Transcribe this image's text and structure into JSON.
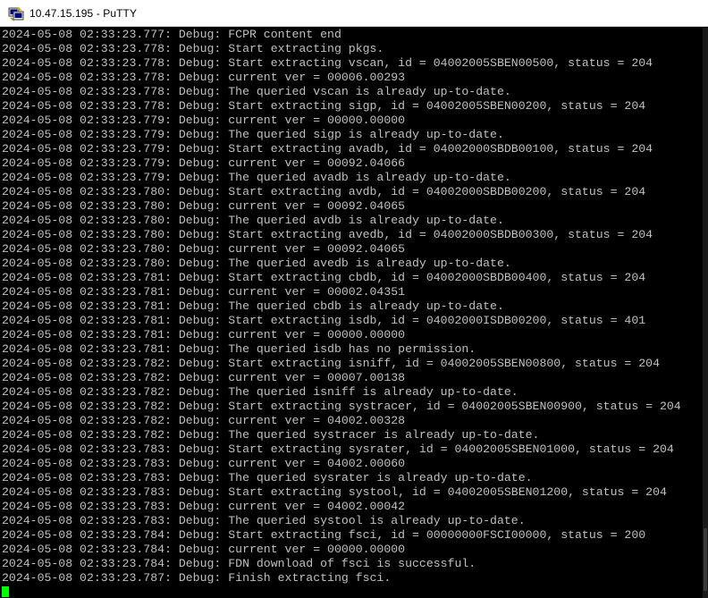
{
  "window": {
    "title": "10.47.15.195 - PuTTY",
    "icon": "putty-icon"
  },
  "terminal": {
    "lines": [
      "2024-05-08 02:33:23.777: Debug: FCPR content end",
      "2024-05-08 02:33:23.778: Debug: Start extracting pkgs.",
      "2024-05-08 02:33:23.778: Debug: Start extracting vscan, id = 04002005SBEN00500, status = 204",
      "2024-05-08 02:33:23.778: Debug: current ver = 00006.00293",
      "2024-05-08 02:33:23.778: Debug: The queried vscan is already up-to-date.",
      "2024-05-08 02:33:23.778: Debug: Start extracting sigp, id = 04002005SBEN00200, status = 204",
      "2024-05-08 02:33:23.779: Debug: current ver = 00000.00000",
      "2024-05-08 02:33:23.779: Debug: The queried sigp is already up-to-date.",
      "2024-05-08 02:33:23.779: Debug: Start extracting avadb, id = 04002000SBDB00100, status = 204",
      "2024-05-08 02:33:23.779: Debug: current ver = 00092.04066",
      "2024-05-08 02:33:23.779: Debug: The queried avadb is already up-to-date.",
      "2024-05-08 02:33:23.780: Debug: Start extracting avdb, id = 04002000SBDB00200, status = 204",
      "2024-05-08 02:33:23.780: Debug: current ver = 00092.04065",
      "2024-05-08 02:33:23.780: Debug: The queried avdb is already up-to-date.",
      "2024-05-08 02:33:23.780: Debug: Start extracting avedb, id = 04002000SBDB00300, status = 204",
      "2024-05-08 02:33:23.780: Debug: current ver = 00092.04065",
      "2024-05-08 02:33:23.780: Debug: The queried avedb is already up-to-date.",
      "2024-05-08 02:33:23.781: Debug: Start extracting cbdb, id = 04002000SBDB00400, status = 204",
      "2024-05-08 02:33:23.781: Debug: current ver = 00002.04351",
      "2024-05-08 02:33:23.781: Debug: The queried cbdb is already up-to-date.",
      "2024-05-08 02:33:23.781: Debug: Start extracting isdb, id = 04002000ISDB00200, status = 401",
      "2024-05-08 02:33:23.781: Debug: current ver = 00000.00000",
      "2024-05-08 02:33:23.781: Debug: The queried isdb has no permission.",
      "2024-05-08 02:33:23.782: Debug: Start extracting isniff, id = 04002005SBEN00800, status = 204",
      "2024-05-08 02:33:23.782: Debug: current ver = 00007.00138",
      "2024-05-08 02:33:23.782: Debug: The queried isniff is already up-to-date.",
      "2024-05-08 02:33:23.782: Debug: Start extracting systracer, id = 04002005SBEN00900, status = 204",
      "2024-05-08 02:33:23.782: Debug: current ver = 04002.00328",
      "2024-05-08 02:33:23.782: Debug: The queried systracer is already up-to-date.",
      "2024-05-08 02:33:23.783: Debug: Start extracting sysrater, id = 04002005SBEN01000, status = 204",
      "2024-05-08 02:33:23.783: Debug: current ver = 04002.00060",
      "2024-05-08 02:33:23.783: Debug: The queried sysrater is already up-to-date.",
      "2024-05-08 02:33:23.783: Debug: Start extracting systool, id = 04002005SBEN01200, status = 204",
      "2024-05-08 02:33:23.783: Debug: current ver = 04002.00042",
      "2024-05-08 02:33:23.783: Debug: The queried systool is already up-to-date.",
      "2024-05-08 02:33:23.784: Debug: Start extracting fsci, id = 00000000FSCI00000, status = 200",
      "2024-05-08 02:33:23.784: Debug: current ver = 00000.00000",
      "2024-05-08 02:33:23.784: Debug: FDN download of fsci is successful.",
      "2024-05-08 02:33:23.787: Debug: Finish extracting fsci."
    ]
  },
  "colors": {
    "terminal_bg": "#000000",
    "terminal_fg": "#c0c0c0",
    "cursor": "#00ff00",
    "titlebar_bg": "#ffffff"
  }
}
